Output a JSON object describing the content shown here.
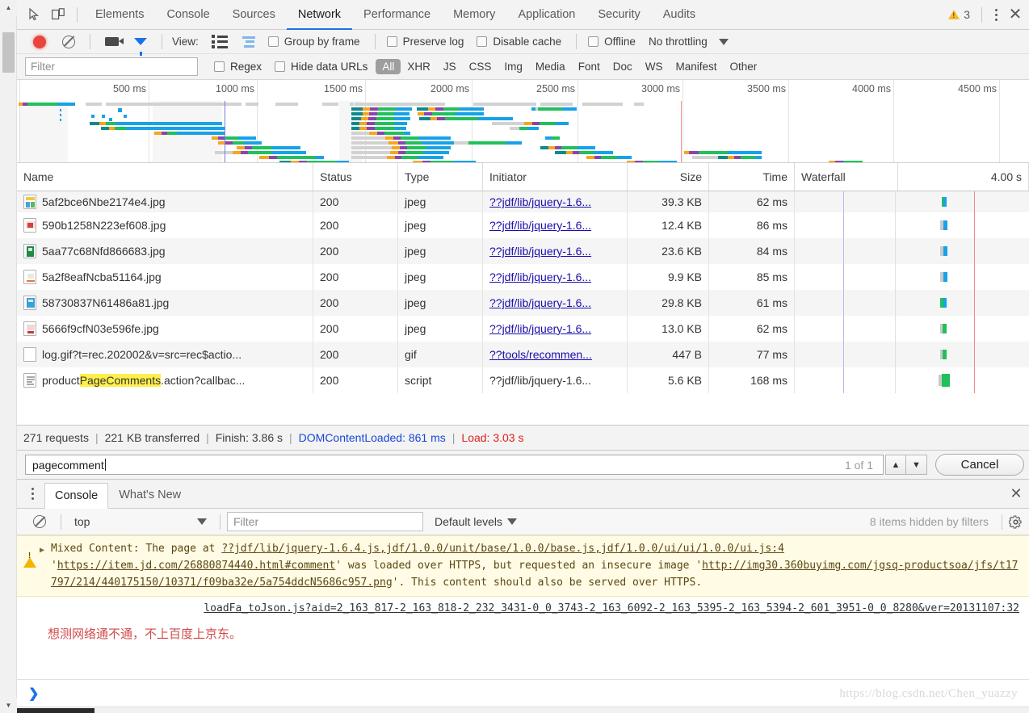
{
  "window": {
    "tabs": [
      {
        "label": "Elements",
        "active": false
      },
      {
        "label": "Console",
        "active": false
      },
      {
        "label": "Sources",
        "active": false
      },
      {
        "label": "Network",
        "active": true
      },
      {
        "label": "Performance",
        "active": false
      },
      {
        "label": "Memory",
        "active": false
      },
      {
        "label": "Application",
        "active": false
      },
      {
        "label": "Security",
        "active": false
      },
      {
        "label": "Audits",
        "active": false
      }
    ],
    "warning_count": "3",
    "inspect_icon": "inspect-element-icon",
    "device_icon": "device-toolbar-icon",
    "more_icon": "kebab-menu-icon",
    "close_icon": "close-icon"
  },
  "network_toolbar": {
    "record_icon": "record-button-icon",
    "clear_icon": "clear-icon",
    "screenshot_icon": "camera-icon",
    "filter_icon": "funnel-icon",
    "view_label": "View:",
    "view_list_icon": "list-view-icon",
    "view_waterfall_icon": "waterfall-view-icon",
    "group_by_frame": "Group by frame",
    "preserve_log": "Preserve log",
    "disable_cache": "Disable cache",
    "offline": "Offline",
    "throttling": "No throttling",
    "throttling_caret": "chevron-down-icon"
  },
  "filter_row": {
    "filter_placeholder": "Filter",
    "regex_label": "Regex",
    "hide_data_urls_label": "Hide data URLs",
    "types": [
      {
        "label": "All",
        "active": true
      },
      {
        "label": "XHR",
        "active": false
      },
      {
        "label": "JS",
        "active": false
      },
      {
        "label": "CSS",
        "active": false
      },
      {
        "label": "Img",
        "active": false
      },
      {
        "label": "Media",
        "active": false
      },
      {
        "label": "Font",
        "active": false
      },
      {
        "label": "Doc",
        "active": false
      },
      {
        "label": "WS",
        "active": false
      },
      {
        "label": "Manifest",
        "active": false
      },
      {
        "label": "Other",
        "active": false
      }
    ]
  },
  "overview": {
    "ticks": [
      "500 ms",
      "1000 ms",
      "1500 ms",
      "2000 ms",
      "2500 ms",
      "3000 ms",
      "3500 ms",
      "4000 ms",
      "4500 ms"
    ],
    "domcontentloaded_marker_ms": 861,
    "load_marker_ms": 3030
  },
  "table": {
    "columns": [
      "Name",
      "Status",
      "Type",
      "Initiator",
      "Size",
      "Time",
      "Waterfall"
    ],
    "waterfall_scale_label": "4.00 s",
    "rows": [
      {
        "name": "5af2bce6Nbe2174e4.jpg",
        "status": "200",
        "type": "jpeg",
        "initiator": "??jdf/lib/jquery-1.6...",
        "size": "39.3 KB",
        "time": "62 ms",
        "icon": "image-file-icon",
        "highlight": ""
      },
      {
        "name": "590b1258N223ef608.jpg",
        "status": "200",
        "type": "jpeg",
        "initiator": "??jdf/lib/jquery-1.6...",
        "size": "12.4 KB",
        "time": "86 ms",
        "icon": "image-file-icon",
        "highlight": ""
      },
      {
        "name": "5aa77c68Nfd866683.jpg",
        "status": "200",
        "type": "jpeg",
        "initiator": "??jdf/lib/jquery-1.6...",
        "size": "23.6 KB",
        "time": "84 ms",
        "icon": "image-file-icon",
        "highlight": ""
      },
      {
        "name": "5a2f8eafNcba51164.jpg",
        "status": "200",
        "type": "jpeg",
        "initiator": "??jdf/lib/jquery-1.6...",
        "size": "9.9 KB",
        "time": "85 ms",
        "icon": "image-file-icon",
        "highlight": ""
      },
      {
        "name": "58730837N61486a81.jpg",
        "status": "200",
        "type": "jpeg",
        "initiator": "??jdf/lib/jquery-1.6...",
        "size": "29.8 KB",
        "time": "61 ms",
        "icon": "image-file-icon",
        "highlight": ""
      },
      {
        "name": "5666f9cfN03e596fe.jpg",
        "status": "200",
        "type": "jpeg",
        "initiator": "??jdf/lib/jquery-1.6...",
        "size": "13.0 KB",
        "time": "62 ms",
        "icon": "image-file-icon",
        "highlight": ""
      },
      {
        "name": "log.gif?t=rec.202002&v=src=rec$actio...",
        "status": "200",
        "type": "gif",
        "initiator": "??tools/recommen...",
        "size": "447 B",
        "time": "77 ms",
        "icon": "image-file-icon",
        "highlight": ""
      },
      {
        "name": "productPageComments.action?callbac...",
        "status": "200",
        "type": "script",
        "initiator": "??jdf/lib/jquery-1.6...",
        "size": "5.6 KB",
        "time": "168 ms",
        "icon": "script-file-icon",
        "highlight": "PageComments",
        "name_pre": "product",
        "name_post": ".action?callbac..."
      }
    ]
  },
  "summary": {
    "requests": "271 requests",
    "transferred": "221 KB transferred",
    "finish": "Finish: 3.86 s",
    "dom_content_loaded": "DOMContentLoaded: 861 ms",
    "load": "Load: 3.03 s",
    "separator": "|"
  },
  "search": {
    "value": "pagecomment",
    "match_count": "1 of 1",
    "prev_icon": "chevron-up-icon",
    "next_icon": "chevron-down-icon",
    "cancel_label": "Cancel"
  },
  "drawer": {
    "menu_icon": "kebab-menu-icon",
    "tabs": [
      {
        "label": "Console",
        "active": true
      },
      {
        "label": "What's New",
        "active": false
      }
    ],
    "close_icon": "close-icon",
    "clear_icon": "clear-console-icon",
    "context": "top",
    "context_caret": "chevron-down-icon",
    "filter_placeholder": "Filter",
    "levels": "Default levels",
    "levels_caret": "chevron-down-icon",
    "hidden_items": "8 items hidden by filters",
    "settings_icon": "gear-icon"
  },
  "console": {
    "warning": {
      "icon": "warning-triangle-icon",
      "expander": "expand-arrow-icon",
      "prefix": "Mixed Content: The page at ",
      "source_link": "??jdf/lib/jquery-1.6.4.js,jdf/1.0.0/unit/base/1.0.0/base.js,jdf/1.0.0/ui/ui/1.0.0/ui.js:4",
      "middle_open": "'",
      "page_url": "https://item.jd.com/26880874440.html#comment",
      "middle": "' was loaded over HTTPS, but requested an insecure image '",
      "image_url": "http://img30.360buyimg.com/jgsq-productsoa/jfs/t17797/214/440175150/10371/f09ba32e/5a754ddcN5686c957.png",
      "suffix": "'. This content should also be served over HTTPS."
    },
    "link_message": "loadFa_toJson.js?aid=2_163_817-2_163_818-2_232_3431-0_0_3743-2_163_6092-2_163_5395-2_163_5394-2_601_3951-0_0_8280&ver=20131107:32",
    "red_message": "想测网络通不通，不上百度上京东。",
    "prompt_chevron": "prompt-chevron-icon"
  },
  "watermark": "https://blog.csdn.net/Chen_yuazzy"
}
